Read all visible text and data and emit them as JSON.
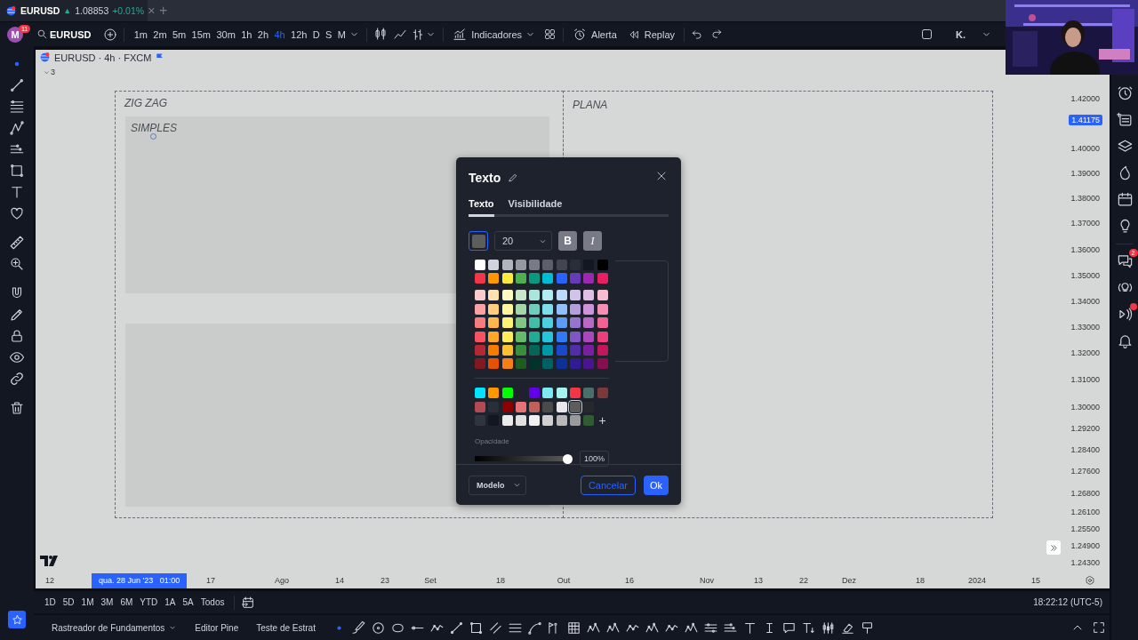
{
  "browser_tab": {
    "symbol": "EURUSD",
    "arrow": "▲",
    "price": "1.08853",
    "change": "+0.01%",
    "close": "×",
    "add": "+"
  },
  "user": {
    "initial": "M",
    "notifications": "11"
  },
  "search": {
    "value": "EURUSD"
  },
  "intervals": [
    {
      "label": "1m",
      "selected": false
    },
    {
      "label": "2m",
      "selected": false
    },
    {
      "label": "5m",
      "selected": false
    },
    {
      "label": "15m",
      "selected": false
    },
    {
      "label": "30m",
      "selected": false
    },
    {
      "label": "1h",
      "selected": false
    },
    {
      "label": "2h",
      "selected": false
    },
    {
      "label": "4h",
      "selected": true
    },
    {
      "label": "12h",
      "selected": false
    },
    {
      "label": "D",
      "selected": false
    },
    {
      "label": "S",
      "selected": false
    },
    {
      "label": "M",
      "selected": false
    }
  ],
  "indicators_button": "Indicadores",
  "alert_button": "Alerta",
  "replay_button": "Replay",
  "layout_name": "K.",
  "legend": {
    "title": "EURUSD · 4h · FXCM",
    "hidden_count": "3"
  },
  "canvas_texts": [
    "ZIG ZAG",
    "SIMPLES",
    "PLANA"
  ],
  "price_axis": {
    "labels": [
      "1.42000",
      "1.40000",
      "1.39000",
      "1.38000",
      "1.37000",
      "1.36000",
      "1.35000",
      "1.34000",
      "1.33000",
      "1.32000",
      "1.31000",
      "1.30000",
      "1.29200",
      "1.28400",
      "1.27600",
      "1.26800",
      "1.26100",
      "1.25500",
      "1.24900",
      "1.24300"
    ],
    "current": "1.41175"
  },
  "time_axis": {
    "labels": [
      "12",
      "17",
      "Ago",
      "14",
      "23",
      "Set",
      "18",
      "Out",
      "16",
      "Nov",
      "13",
      "22",
      "Dez",
      "18",
      "2024",
      "15"
    ],
    "cursor": "qua. 28 Jun '23   01:00"
  },
  "ranges": [
    "1D",
    "5D",
    "1M",
    "3M",
    "6M",
    "YTD",
    "1A",
    "5A",
    "Todos"
  ],
  "clock": "18:22:12 (UTC-5)",
  "bottom_tabs": [
    "Rastreador de Fundamentos",
    "Editor Pine",
    "Teste de Estrat"
  ],
  "chat_badge": "2",
  "dialog": {
    "title": "Texto",
    "tabs": [
      {
        "label": "Texto",
        "selected": true
      },
      {
        "label": "Visibilidade",
        "selected": false
      }
    ],
    "font_size": "20",
    "bold": true,
    "bold_label": "B",
    "italic": true,
    "italic_label": "I",
    "palette": [
      {
        "color": "#ffffff"
      },
      {
        "color": "#d1d4dc"
      },
      {
        "color": "#b2b5be"
      },
      {
        "color": "#9598a1"
      },
      {
        "color": "#787b86"
      },
      {
        "color": "#5d606b"
      },
      {
        "color": "#434651"
      },
      {
        "color": "#2a2e39"
      },
      {
        "color": "#131722"
      },
      {
        "color": "#000000"
      },
      {
        "color": "#f23645"
      },
      {
        "color": "#ff9800"
      },
      {
        "color": "#ffeb3b"
      },
      {
        "color": "#4caf50"
      },
      {
        "color": "#089981"
      },
      {
        "color": "#00bcd4"
      },
      {
        "color": "#2962ff"
      },
      {
        "color": "#673ab7"
      },
      {
        "color": "#9c27b0"
      },
      {
        "color": "#e91e63"
      },
      {
        "color": "#fccbcd"
      },
      {
        "color": "#ffe0b2"
      },
      {
        "color": "#fff9c4"
      },
      {
        "color": "#c8e6c9"
      },
      {
        "color": "#ace5dc"
      },
      {
        "color": "#b2ebf2"
      },
      {
        "color": "#bbd9fb"
      },
      {
        "color": "#d1c4e9"
      },
      {
        "color": "#e1bee7"
      },
      {
        "color": "#f8bbd0"
      },
      {
        "color": "#faa1a4"
      },
      {
        "color": "#ffcc80"
      },
      {
        "color": "#fff59d"
      },
      {
        "color": "#a5d6a7"
      },
      {
        "color": "#70ccbd"
      },
      {
        "color": "#80deea"
      },
      {
        "color": "#90bff9"
      },
      {
        "color": "#b39ddb"
      },
      {
        "color": "#ce93d8"
      },
      {
        "color": "#f48fb1"
      },
      {
        "color": "#f77c80"
      },
      {
        "color": "#ffb74d"
      },
      {
        "color": "#fff176"
      },
      {
        "color": "#81c784"
      },
      {
        "color": "#42bda8"
      },
      {
        "color": "#4dd0e1"
      },
      {
        "color": "#5b9cf6"
      },
      {
        "color": "#9575cd"
      },
      {
        "color": "#ba68c8"
      },
      {
        "color": "#f06292"
      },
      {
        "color": "#f7525f"
      },
      {
        "color": "#ffa726"
      },
      {
        "color": "#ffee58"
      },
      {
        "color": "#66bb6a"
      },
      {
        "color": "#22ab94"
      },
      {
        "color": "#26c6da"
      },
      {
        "color": "#3179f5"
      },
      {
        "color": "#7e57c2"
      },
      {
        "color": "#ab47bc"
      },
      {
        "color": "#ec407a"
      },
      {
        "color": "#b22833"
      },
      {
        "color": "#f57c00"
      },
      {
        "color": "#fbc02d"
      },
      {
        "color": "#388e3c"
      },
      {
        "color": "#056656"
      },
      {
        "color": "#0097a7"
      },
      {
        "color": "#1848cc"
      },
      {
        "color": "#512da8"
      },
      {
        "color": "#7b1fa2"
      },
      {
        "color": "#c2185b"
      },
      {
        "color": "#801922"
      },
      {
        "color": "#e65100"
      },
      {
        "color": "#f57f17"
      },
      {
        "color": "#1b5e20"
      },
      {
        "color": "#00332a"
      },
      {
        "color": "#006064"
      },
      {
        "color": "#0c3299"
      },
      {
        "color": "#311b92"
      },
      {
        "color": "#4a148c"
      },
      {
        "color": "#880e4f"
      }
    ],
    "custom_colors": [
      {
        "kind": "swatch",
        "color": "#00e5ff",
        "selected": false
      },
      {
        "kind": "swatch",
        "color": "#ff9800",
        "selected": false
      },
      {
        "kind": "swatch",
        "color": "#00ff00",
        "selected": false
      },
      {
        "kind": "gap"
      },
      {
        "kind": "swatch",
        "color": "#6200ea",
        "selected": false
      },
      {
        "kind": "swatch",
        "color": "#7ee8f0",
        "selected": false
      },
      {
        "kind": "swatch",
        "color": "#a6f2f0",
        "selected": false
      },
      {
        "kind": "swatch",
        "color": "#f23645",
        "selected": false
      },
      {
        "kind": "swatch",
        "color": "#4a6e6a",
        "selected": false
      },
      {
        "kind": "swatch",
        "color": "#7a3a3a",
        "selected": false
      },
      {
        "kind": "swatch",
        "color": "#b04a55",
        "selected": false
      },
      {
        "kind": "swatch",
        "color": "#2a2e39",
        "selected": false
      },
      {
        "kind": "swatch",
        "color": "#8b0000",
        "selected": false
      },
      {
        "kind": "swatch",
        "color": "#e57373",
        "selected": false
      },
      {
        "kind": "swatch",
        "color": "#c0605a",
        "selected": false
      },
      {
        "kind": "swatch",
        "color": "#4a4a4a",
        "selected": false
      },
      {
        "kind": "swatch",
        "color": "#e8e8ec",
        "selected": false
      },
      {
        "kind": "swatch",
        "color": "#5d5d5d",
        "selected": true
      },
      {
        "kind": "swatch",
        "color": "#262a2e",
        "selected": false
      },
      {
        "kind": "gap"
      },
      {
        "kind": "swatch",
        "color": "#30343e",
        "selected": false
      },
      {
        "kind": "swatch",
        "color": "#131722",
        "selected": false
      },
      {
        "kind": "swatch",
        "color": "#ebebeb",
        "selected": false
      },
      {
        "kind": "swatch",
        "color": "#e0e0e0",
        "selected": false
      },
      {
        "kind": "swatch",
        "color": "#f0f0f0",
        "selected": false
      },
      {
        "kind": "swatch",
        "color": "#d0d0d0",
        "selected": false
      },
      {
        "kind": "swatch",
        "color": "#b8b8b8",
        "selected": false
      },
      {
        "kind": "swatch",
        "color": "#9a9a9a",
        "selected": false
      },
      {
        "kind": "swatch",
        "color": "#2e5e30",
        "selected": false
      }
    ],
    "add_color": "+",
    "opacity": {
      "label": "Opacidade",
      "level": 0.96,
      "value": "100%"
    },
    "template_button": "Modelo",
    "cancel_button": "Cancelar",
    "ok_button": "Ok"
  }
}
